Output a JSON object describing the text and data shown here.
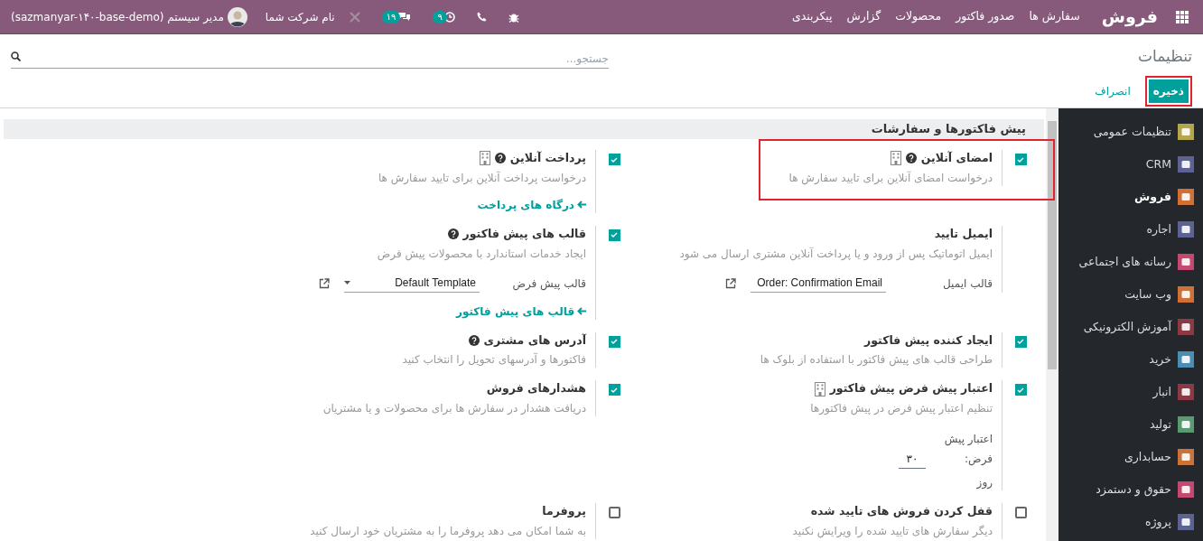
{
  "navbar": {
    "brand": "فروش",
    "menu": [
      "سفارش ها",
      "صدور فاکتور",
      "محصولات",
      "گزارش",
      "پیکربندی"
    ],
    "activities_badge": "۹",
    "messages_badge": "۱۹",
    "company": "نام شرکت شما",
    "user": "مدیر سیستم (sazmanyar-۱۴۰-base-demo)"
  },
  "control_panel": {
    "breadcrumb": "تنظیمات",
    "search": {
      "placeholder": "جستجو..."
    },
    "buttons": [
      {
        "label": "ذخیره",
        "kind": "primary",
        "highlighted": true
      },
      {
        "label": "انصراف",
        "kind": "link",
        "highlighted": false
      }
    ]
  },
  "sidebar": {
    "items": [
      {
        "label": "تنظیمات عمومی",
        "color": "#b5a64c",
        "selected": false
      },
      {
        "label": "CRM",
        "color": "#5c6392",
        "selected": false
      },
      {
        "label": "فروش",
        "color": "#cf7137",
        "selected": true
      },
      {
        "label": "اجاره",
        "color": "#5c6392",
        "selected": false
      },
      {
        "label": "رسانه های اجتماعی",
        "color": "#c54870",
        "selected": false
      },
      {
        "label": "وب سایت",
        "color": "#cf7137",
        "selected": false
      },
      {
        "label": "آموزش الکترونیکی",
        "color": "#8b3a44",
        "selected": false
      },
      {
        "label": "خرید",
        "color": "#4b8db3",
        "selected": false
      },
      {
        "label": "انبار",
        "color": "#8b3a44",
        "selected": false
      },
      {
        "label": "تولید",
        "color": "#5a9a70",
        "selected": false
      },
      {
        "label": "حسابداری",
        "color": "#c9733a",
        "selected": false
      },
      {
        "label": "حقوق و دستمزد",
        "color": "#c54870",
        "selected": false
      },
      {
        "label": "پروژه",
        "color": "#5c6392",
        "selected": false
      }
    ]
  },
  "section": {
    "title": "پیش فاکتورها و سفارشات",
    "settings": [
      {
        "kind": "checkbox",
        "checked": true,
        "highlighted": true,
        "title": "امضای آنلاین",
        "help": true,
        "enterprise": true,
        "description": "درخواست امضای آنلاین برای تایید سفارش ها"
      },
      {
        "kind": "checkbox",
        "checked": true,
        "highlighted": false,
        "title": "پرداخت آنلاین",
        "help": true,
        "enterprise": true,
        "description": "درخواست پرداخت آنلاین برای تایید سفارش ها",
        "link": "درگاه های پرداخت"
      },
      {
        "kind": "plain",
        "highlighted": false,
        "title": "ایمیل تایید",
        "help": false,
        "enterprise": false,
        "description": "ایمیل اتوماتیک پس از ورود و یا پرداخت آنلاین مشتری ارسال می شود",
        "select": {
          "label": "قالب ایمیل",
          "value": "Order: Confirmation Email"
        }
      },
      {
        "kind": "checkbox",
        "checked": true,
        "highlighted": false,
        "title": "قالب های پیش فاکتور",
        "help": true,
        "enterprise": false,
        "description": "ایجاد خدمات استاندارد با محصولات پیش فرض",
        "select": {
          "label": "قالب پیش فرض",
          "value": "Default Template"
        },
        "link": "قالب های پیش فاکتور"
      },
      {
        "kind": "checkbox",
        "checked": true,
        "highlighted": false,
        "title": "ایجاد کننده پیش فاکتور",
        "help": false,
        "enterprise": false,
        "description": "طراحی قالب های پیش فاکتور با استفاده از بلوک ها"
      },
      {
        "kind": "checkbox",
        "checked": true,
        "highlighted": false,
        "title": "آدرس های مشتری",
        "help": true,
        "enterprise": false,
        "description": "فاکتورها و آدرسهای تحویل را انتخاب کنید"
      },
      {
        "kind": "checkbox",
        "checked": true,
        "highlighted": false,
        "title": "اعتبار پیش فرض پیش فاکتور",
        "help": false,
        "enterprise": true,
        "description": "تنظیم اعتبار پیش فرض در پیش فاکتورها",
        "number_field": {
          "label": "اعتبار پیش فرض:",
          "value": "۳۰",
          "unit": "روز"
        }
      },
      {
        "kind": "checkbox",
        "checked": true,
        "highlighted": false,
        "title": "هشدارهای فروش",
        "help": false,
        "enterprise": false,
        "description": "دریافت هشدار در سفارش ها برای محصولات و یا مشتریان"
      },
      {
        "kind": "checkbox",
        "checked": false,
        "highlighted": false,
        "title": "قفل کردن فروش های تایید شده",
        "help": false,
        "enterprise": false,
        "description": "دیگر سفارش های تایید شده را ویرایش نکنید"
      },
      {
        "kind": "checkbox",
        "checked": false,
        "highlighted": false,
        "title": "پروفرما",
        "help": false,
        "enterprise": false,
        "description": "به شما امکان می دهد پروفرما را به مشتریان خود ارسال کنید"
      }
    ]
  }
}
